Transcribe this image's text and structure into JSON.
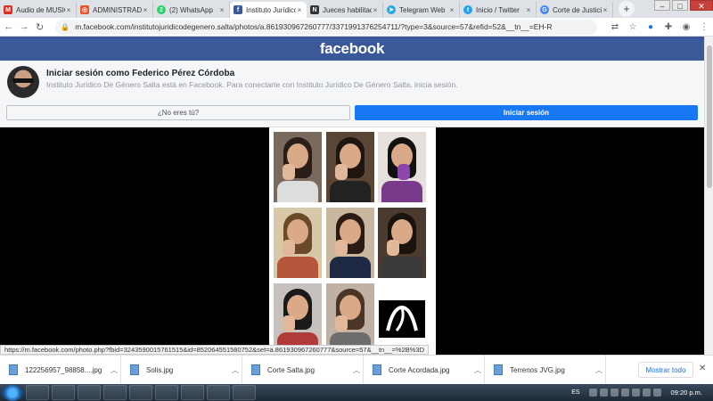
{
  "browser": {
    "tabs": [
      {
        "title": "Audio de MUSIC",
        "favicon": "gmail-icon",
        "color": "#d93025"
      },
      {
        "title": "ADMINISTRADO",
        "favicon": "app-icon",
        "color": "#e8542b"
      },
      {
        "title": "(2) WhatsApp",
        "favicon": "whatsapp-icon",
        "color": "#25d366"
      },
      {
        "title": "Instituto Jurídico",
        "favicon": "facebook-icon",
        "color": "#3b5998",
        "active": true
      },
      {
        "title": "Jueces habilitad",
        "favicon": "ns-icon",
        "color": "#333333"
      },
      {
        "title": "Telegram Web",
        "favicon": "telegram-icon",
        "color": "#2ca5e0"
      },
      {
        "title": "Inicio / Twitter",
        "favicon": "twitter-icon",
        "color": "#1da1f2"
      },
      {
        "title": "Corte de Justicia",
        "favicon": "google-icon",
        "color": "#4285f4"
      }
    ],
    "new_tab_label": "+",
    "url": "m.facebook.com/institutojuridicodegenero.salta/photos/a.861930967260777/3371991376254711/?type=3&source=57&refid=52&__tn__=EH-R"
  },
  "facebook": {
    "logo": "facebook",
    "login_title": "Iniciar sesión como Federico Pérez Córdoba",
    "login_subtitle": "Instituto Jurídico De Género Salta está en Facebook. Para conectarte con Instituto Jurídico De Género Salta, inicia sesión.",
    "not_you_label": "¿No eres tú?",
    "login_button_label": "Iniciar sesión"
  },
  "status_url": "https://m.facebook.com/photo.php?fbid=3243590015761515&id=852064551580752&set=a.861930967260777&source=57&__tn__=%2B%3D",
  "downloads": {
    "items": [
      {
        "name": "122256957_98858....jpg"
      },
      {
        "name": "Solis.jpg"
      },
      {
        "name": "Corte Salta.jpg"
      },
      {
        "name": "Corte Acordada.jpg"
      },
      {
        "name": "Terrenos JVG.jpg"
      }
    ],
    "show_all_label": "Mostrar todo"
  },
  "taskbar": {
    "language": "ES",
    "clock": "09:20 p.m."
  }
}
